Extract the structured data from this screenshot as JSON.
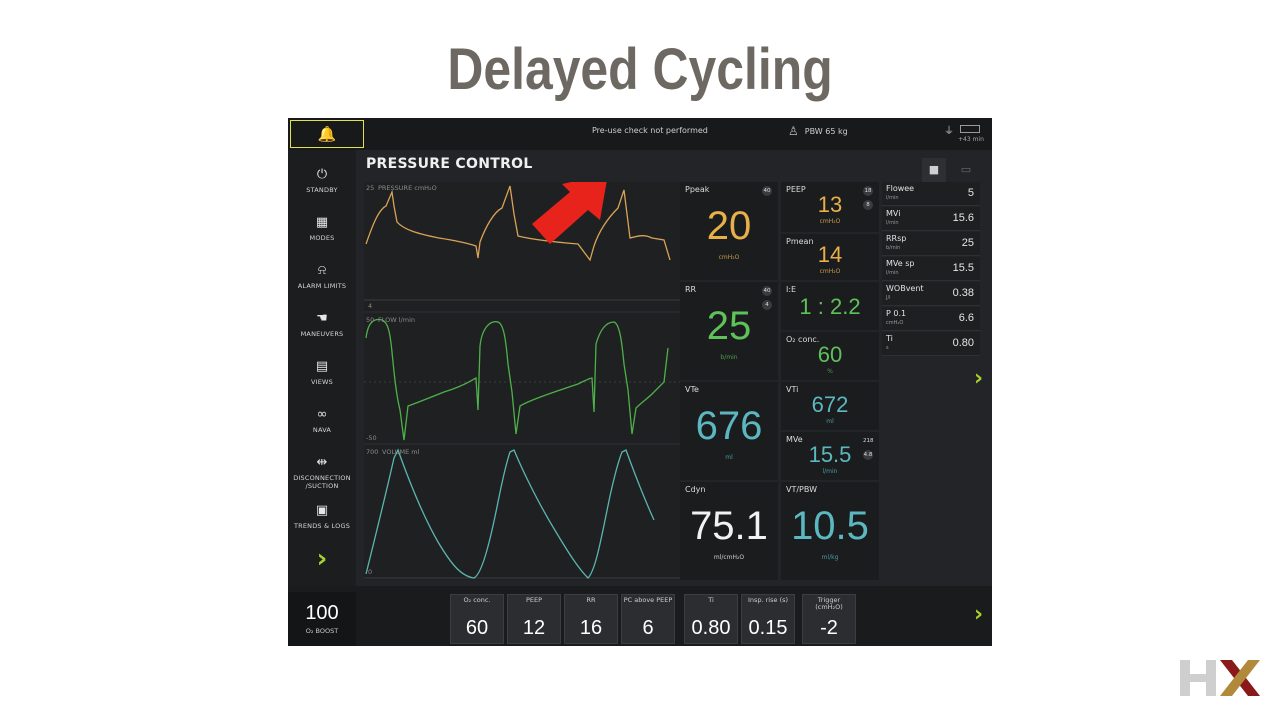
{
  "slide": {
    "title": "Delayed Cycling"
  },
  "topbar": {
    "bell_icon": "bell-icon",
    "status_message": "Pre-use check not performed",
    "pbw": "PBW 65 kg",
    "battery_time": "+43 min"
  },
  "sidebar": {
    "items": [
      {
        "label": "STANDBY",
        "icon": "power-icon"
      },
      {
        "label": "MODES",
        "icon": "grid-icon"
      },
      {
        "label": "ALARM LIMITS",
        "icon": "alarm-icon"
      },
      {
        "label": "MANEUVERS",
        "icon": "hand-icon"
      },
      {
        "label": "VIEWS",
        "icon": "views-icon"
      },
      {
        "label": "NAVA",
        "icon": "nava-icon"
      },
      {
        "label": "DISCONNECTION /SUCTION",
        "icon": "disconnect-icon"
      },
      {
        "label": "TRENDS & LOGS",
        "icon": "trends-icon"
      }
    ],
    "next": "›"
  },
  "main": {
    "mode_title": "PRESSURE CONTROL",
    "waveforms": [
      {
        "label": "PRESSURE cmH₂O",
        "top_scale": "25",
        "bottom_scale": "4"
      },
      {
        "label": "FLOW l/min",
        "top_scale": "50",
        "bottom_scale": "-50"
      },
      {
        "label": "VOLUME ml",
        "top_scale": "700",
        "bottom_scale": "0"
      }
    ]
  },
  "measured": {
    "ppeak": {
      "name": "Ppeak",
      "value": "20",
      "unit": "cmH₂O",
      "badge": "40",
      "color": "#e8b048"
    },
    "peep": {
      "name": "PEEP",
      "value": "13",
      "unit": "cmH₂O",
      "badge": "18",
      "badge2": "8",
      "color": "#e8b048"
    },
    "pmean": {
      "name": "Pmean",
      "value": "14",
      "unit": "cmH₂O",
      "color": "#e8b048"
    },
    "rr": {
      "name": "RR",
      "value": "25",
      "unit": "b/min",
      "badge": "40",
      "badge2": "4",
      "color": "#5fc15a"
    },
    "ie": {
      "name": "I:E",
      "value": "1 : 2.2",
      "color": "#5fc15a"
    },
    "o2": {
      "name": "O₂ conc.",
      "value": "60",
      "unit": "%",
      "color": "#5fc15a"
    },
    "vte": {
      "name": "VTe",
      "value": "676",
      "unit": "ml",
      "color": "#5bb8c0"
    },
    "vti": {
      "name": "VTi",
      "value": "672",
      "unit": "ml",
      "color": "#5bb8c0"
    },
    "mve": {
      "name": "MVe",
      "value": "15.5",
      "unit": "l/min",
      "badge": "218",
      "badge2": "4.8",
      "color": "#5bb8c0"
    },
    "cdyn": {
      "name": "Cdyn",
      "value": "75.1",
      "unit": "ml/cmH₂O",
      "color": "#f2f2f2"
    },
    "vtpbw": {
      "name": "VT/PBW",
      "value": "10.5",
      "unit": "ml/kg",
      "color": "#5bb8c0"
    }
  },
  "small_values": [
    {
      "name": "Flowee",
      "unit": "l/min",
      "value": "5"
    },
    {
      "name": "MVi",
      "unit": "l/min",
      "value": "15.6"
    },
    {
      "name": "RRsp",
      "unit": "b/min",
      "value": "25"
    },
    {
      "name": "MVe sp",
      "unit": "l/min",
      "value": "15.5"
    },
    {
      "name": "WOBvent",
      "unit": "J/l",
      "value": "0.38"
    },
    {
      "name": "P 0.1",
      "unit": "cmH₂O",
      "value": "6.6"
    },
    {
      "name": "Ti",
      "unit": "s",
      "value": "0.80"
    }
  ],
  "bottom": {
    "boost": {
      "value": "100",
      "label": "O₂ BOOST"
    },
    "settings": [
      {
        "label": "O₂ conc.",
        "value": "60"
      },
      {
        "label": "PEEP",
        "value": "12"
      },
      {
        "label": "RR",
        "value": "16"
      },
      {
        "label": "PC above PEEP",
        "value": "6"
      },
      {
        "label": "Ti",
        "value": "0.80"
      },
      {
        "label": "Insp. rise (s)",
        "value": "0.15"
      },
      {
        "label": "Trigger (cmH₂O)",
        "value": "-2"
      }
    ]
  },
  "colors": {
    "pressure": "#d9a356",
    "flow": "#4fb04a",
    "volume": "#5bb5b0",
    "accent": "#a6d22c",
    "arrow": "#e8231c"
  },
  "logo": {
    "text": "HX"
  }
}
